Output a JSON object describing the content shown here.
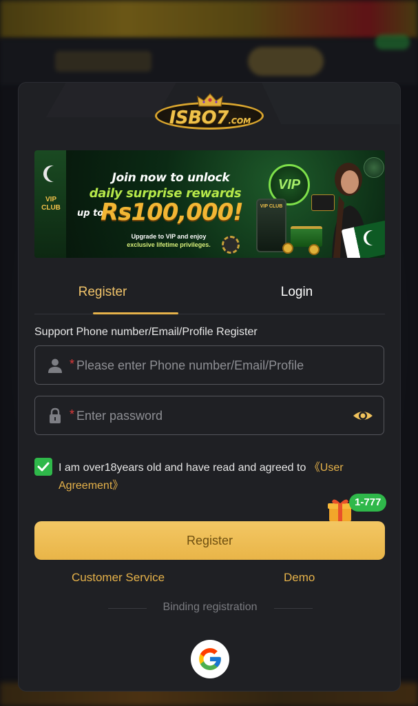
{
  "brand": {
    "logo_text": "ISBO7",
    "logo_suffix": ".COM"
  },
  "banner": {
    "headline_1": "Join now to unlock",
    "headline_2": "daily surprise rewards",
    "up_to": "up to",
    "amount": "Rs100,000!",
    "sub_1": "Upgrade to VIP and enjoy",
    "sub_2": "exclusive lifetime privileges.",
    "vip_club": "VIP CLUB",
    "vip_badge": "VIP",
    "phone_label": "VIP CLUB"
  },
  "tabs": [
    {
      "label": "Register",
      "active": true
    },
    {
      "label": "Login",
      "active": false
    }
  ],
  "form": {
    "support_label": "Support Phone number/Email/Profile Register",
    "phone_placeholder": "Please enter Phone number/Email/Profile",
    "password_placeholder": "Enter password",
    "required_mark": "*",
    "agreement_text": "I am over18years old and have read and agreed to ",
    "agreement_link": "《User Agreement》",
    "checked": true
  },
  "promo_badge": "1-777",
  "register_button": "Register",
  "links": {
    "customer_service": "Customer Service",
    "demo": "Demo"
  },
  "binding_label": "Binding registration",
  "colors": {
    "accent": "#e6b24a",
    "button_bg": "#f0c25c",
    "button_text": "#6e4f10",
    "check_green": "#2fb84a",
    "modal_bg": "#1f2024"
  },
  "icons": [
    "user-icon",
    "lock-icon",
    "eye-icon",
    "check-icon",
    "gift-icon",
    "google-icon",
    "crown-icon"
  ]
}
